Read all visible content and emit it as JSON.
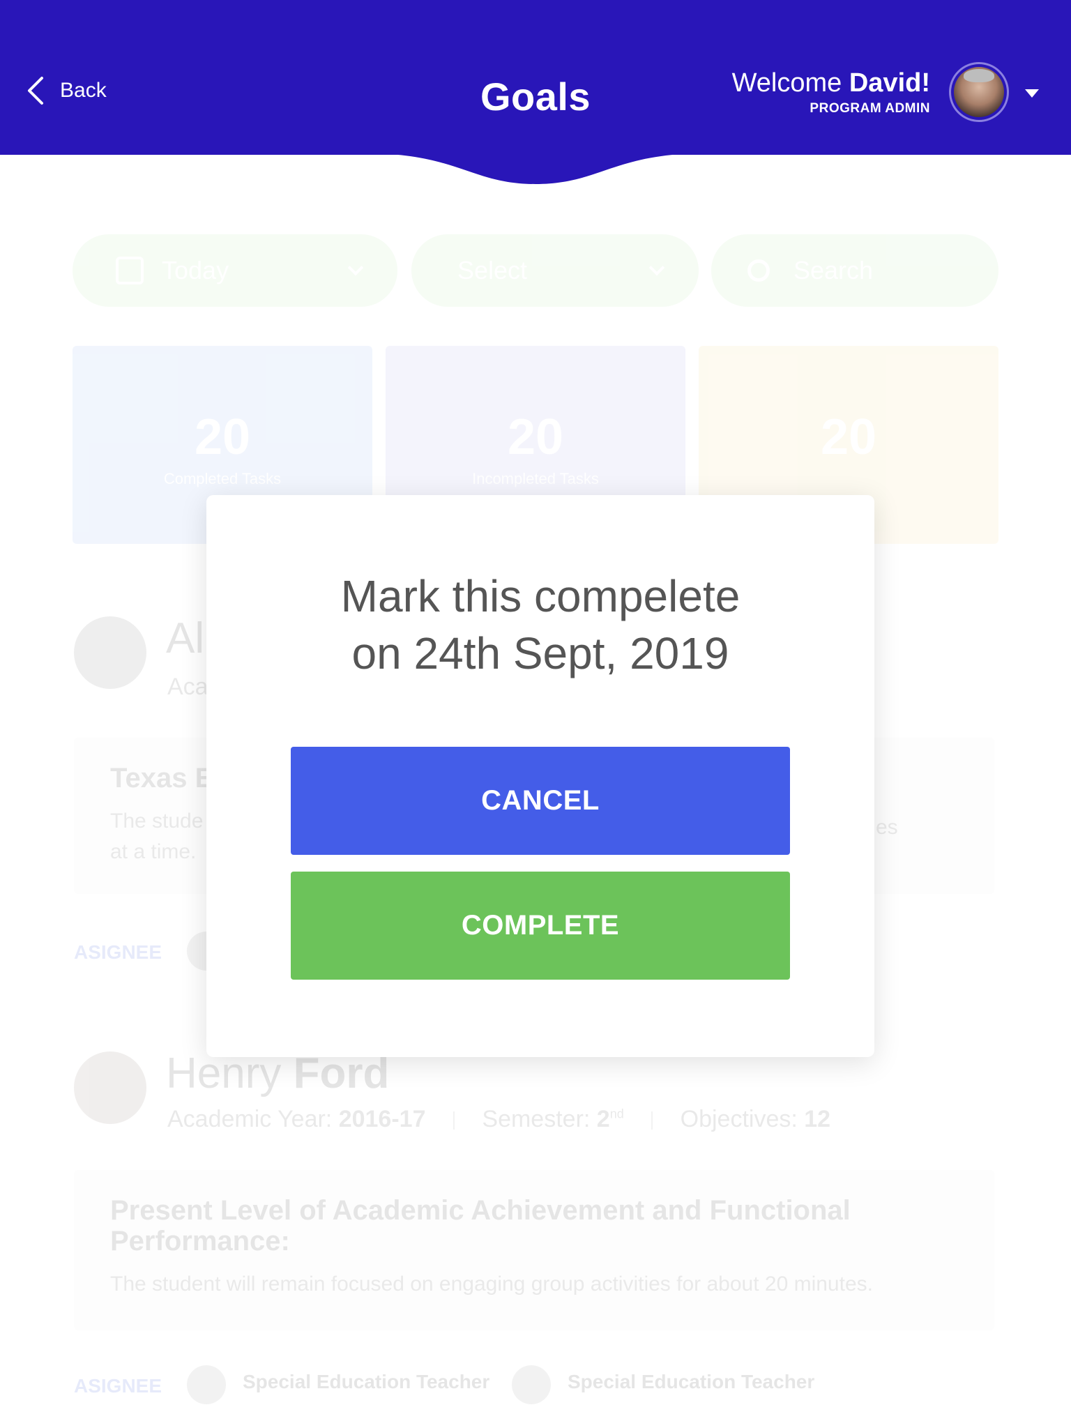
{
  "header": {
    "back_label": "Back",
    "title": "Goals",
    "welcome_greeting": "Welcome ",
    "welcome_name": "David!",
    "role": "PROGRAM ADMIN",
    "profile_menu_icon": "caret-down-icon",
    "colors": {
      "background": "#2916b8",
      "text": "#ffffff"
    }
  },
  "filters": {
    "date_value": "Today",
    "select_placeholder": "Select",
    "search_placeholder": "Search"
  },
  "stats": [
    {
      "value": "20",
      "label": "Completed Tasks"
    },
    {
      "value": "20",
      "label": "Incompleted Tasks"
    },
    {
      "value": "20",
      "label": ""
    }
  ],
  "students": [
    {
      "first_name": "Al",
      "last_name": "",
      "meta": "Aca",
      "card_title": "Texas E",
      "card_text": "The stude",
      "card_text_2": "at a time.",
      "card_text_right": "es",
      "asignee_label": "ASIGNEE"
    },
    {
      "first_name": "Henry ",
      "last_name": "Ford",
      "year_label": "Academic Year: ",
      "year_value": "2016-17",
      "semester_label": "Semester: ",
      "semester_value": "2",
      "semester_suffix": "nd",
      "objectives_label": "Objectives: ",
      "objectives_value": "12",
      "card_title": "Present Level of Academic Achievement and Functional Performance:",
      "card_text": "The student will remain focused on engaging group activities for about 20 minutes.",
      "asignee_label": "ASIGNEE",
      "assignees": [
        "Special Education Teacher",
        "Special Education Teacher"
      ]
    }
  ],
  "modal": {
    "title_line1": "Mark this compelete",
    "title_line2": "on 24th Sept, 2019",
    "cancel_label": "CANCEL",
    "complete_label": "COMPLETE",
    "colors": {
      "cancel": "#445de8",
      "complete": "#6cc35a"
    }
  }
}
